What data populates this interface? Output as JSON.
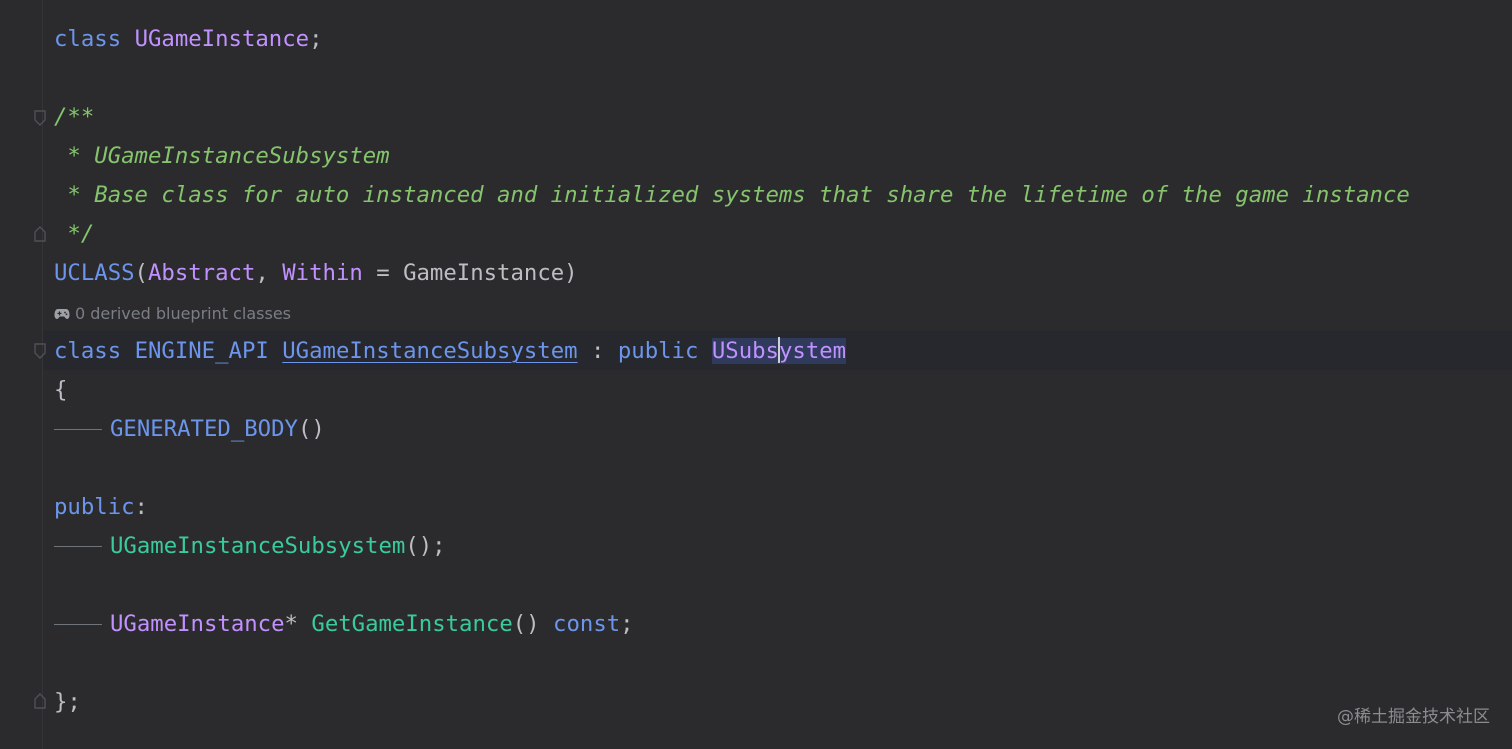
{
  "editor": {
    "lines": {
      "l1": {
        "kw": "class",
        "type": "UGameInstance",
        "punct": ";"
      },
      "l3": {
        "text": "/**"
      },
      "l4": {
        "text": " * UGameInstanceSubsystem"
      },
      "l5": {
        "text": " * Base class for auto instanced and initialized systems that share the lifetime of the game instance"
      },
      "l6": {
        "text": " */"
      },
      "l7": {
        "macro": "UCLASS",
        "open": "(",
        "p1": "Abstract",
        "comma": ", ",
        "p2": "Within",
        "eq": " = ",
        "v": "GameInstance",
        "close": ")"
      },
      "l8": {
        "kw": "class",
        "api": "ENGINE_API",
        "cls": "UGameInstanceSubsystem",
        "colon": " : ",
        "pub": "public",
        "base_a": "USubs",
        "base_b": "ystem"
      },
      "l9": {
        "text": "{"
      },
      "l10": {
        "macro": "GENERATED_BODY",
        "paren": "()"
      },
      "l12": {
        "kw": "public",
        "colon": ":"
      },
      "l13": {
        "fn": "UGameInstanceSubsystem",
        "rest": "();"
      },
      "l15": {
        "type": "UGameInstance",
        "star": "*",
        "fn": "GetGameInstance",
        "paren": "()",
        "kw": "const",
        "semi": ";"
      },
      "l17": {
        "text": "};"
      }
    },
    "hint": {
      "icon": "gamepad-icon",
      "text": "0 derived blueprint classes"
    }
  },
  "watermark": "@稀土掘金技术社区",
  "colors": {
    "background": "#2b2b2d",
    "keyword": "#6c95eb",
    "type": "#c191ff",
    "function": "#39cc9b",
    "comment": "#85c46c",
    "text": "#bcbec4"
  }
}
